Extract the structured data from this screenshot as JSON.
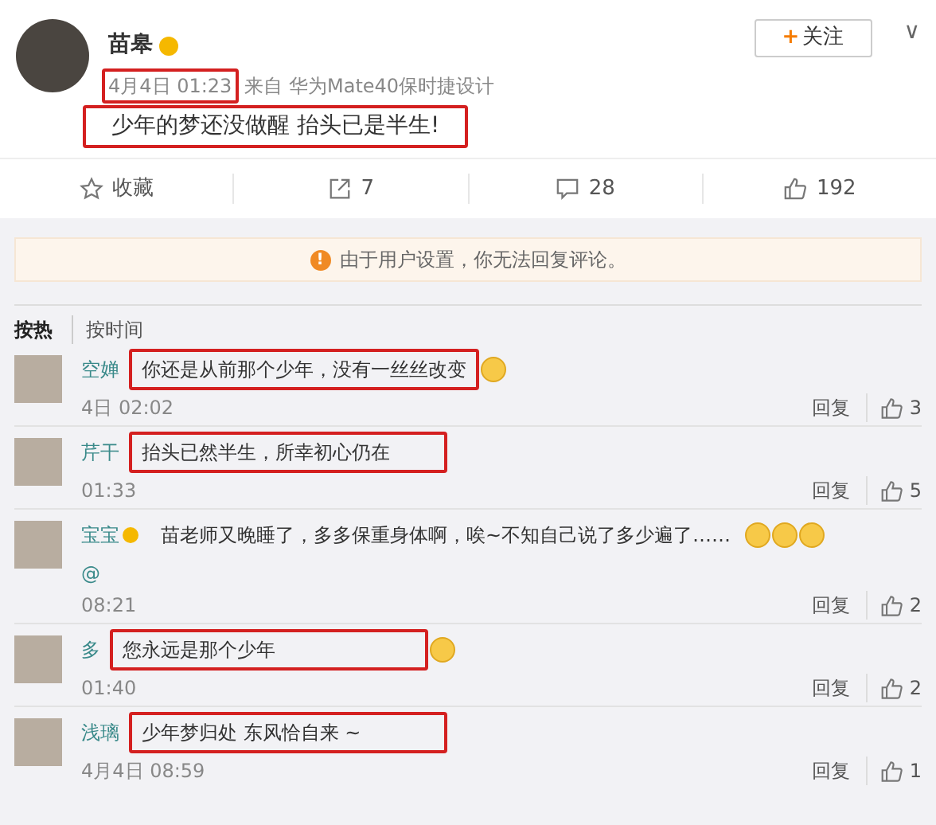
{
  "post": {
    "author": "苗皋",
    "verified": true,
    "time": "4月4日 01:23",
    "time_boxed": true,
    "source": "来自 华为Mate40保时捷设计",
    "text": "少年的梦还没做醒 抬头已是半生!",
    "text_boxed": true,
    "follow_plus": "+",
    "follow_label": "关注",
    "menu_glyph": "∨"
  },
  "actions": [
    {
      "kind": "star",
      "label": "收藏"
    },
    {
      "kind": "share",
      "label": "7"
    },
    {
      "kind": "comment",
      "label": "28"
    },
    {
      "kind": "like",
      "label": "192"
    }
  ],
  "notice": {
    "icon": "!",
    "text": "由于用户设置，你无法回复评论。"
  },
  "sort_tabs": [
    {
      "label": "按热",
      "selected": true
    },
    {
      "label": "按时间",
      "selected": false
    }
  ],
  "comments": [
    {
      "name": "空婵",
      "verified": false,
      "text": "你还是从前那个少年，没有一丝丝改变",
      "emojis": [
        {
          "kind": "face"
        }
      ],
      "time": "4日 02:02",
      "reply": "回复",
      "likes": "3",
      "boxed": true
    },
    {
      "name": "芹干",
      "verified": false,
      "text": "抬头已然半生，所幸初心仍在",
      "time": "01:33",
      "reply": "回复",
      "likes": "5",
      "boxed": true
    },
    {
      "name": "宝宝",
      "verified": true,
      "text": "苗老师又晚睡了，多多保重身体啊，唉~不知自己说了多少遍了……",
      "emojis": [
        {
          "kind": "face"
        },
        {
          "kind": "face"
        },
        {
          "kind": "face"
        }
      ],
      "mention": "@",
      "time": "08:21",
      "reply": "回复",
      "likes": "2",
      "boxed": false
    },
    {
      "name": "多",
      "verified": false,
      "text": "您永远是那个少年",
      "emojis": [
        {
          "kind": "face"
        }
      ],
      "time": "01:40",
      "reply": "回复",
      "likes": "2",
      "boxed": true
    },
    {
      "name": "浅璃",
      "verified": false,
      "text": "少年梦归处 东风恰自来 ~",
      "time": "4月4日 08:59",
      "reply": "回复",
      "likes": "1",
      "boxed": true
    }
  ]
}
